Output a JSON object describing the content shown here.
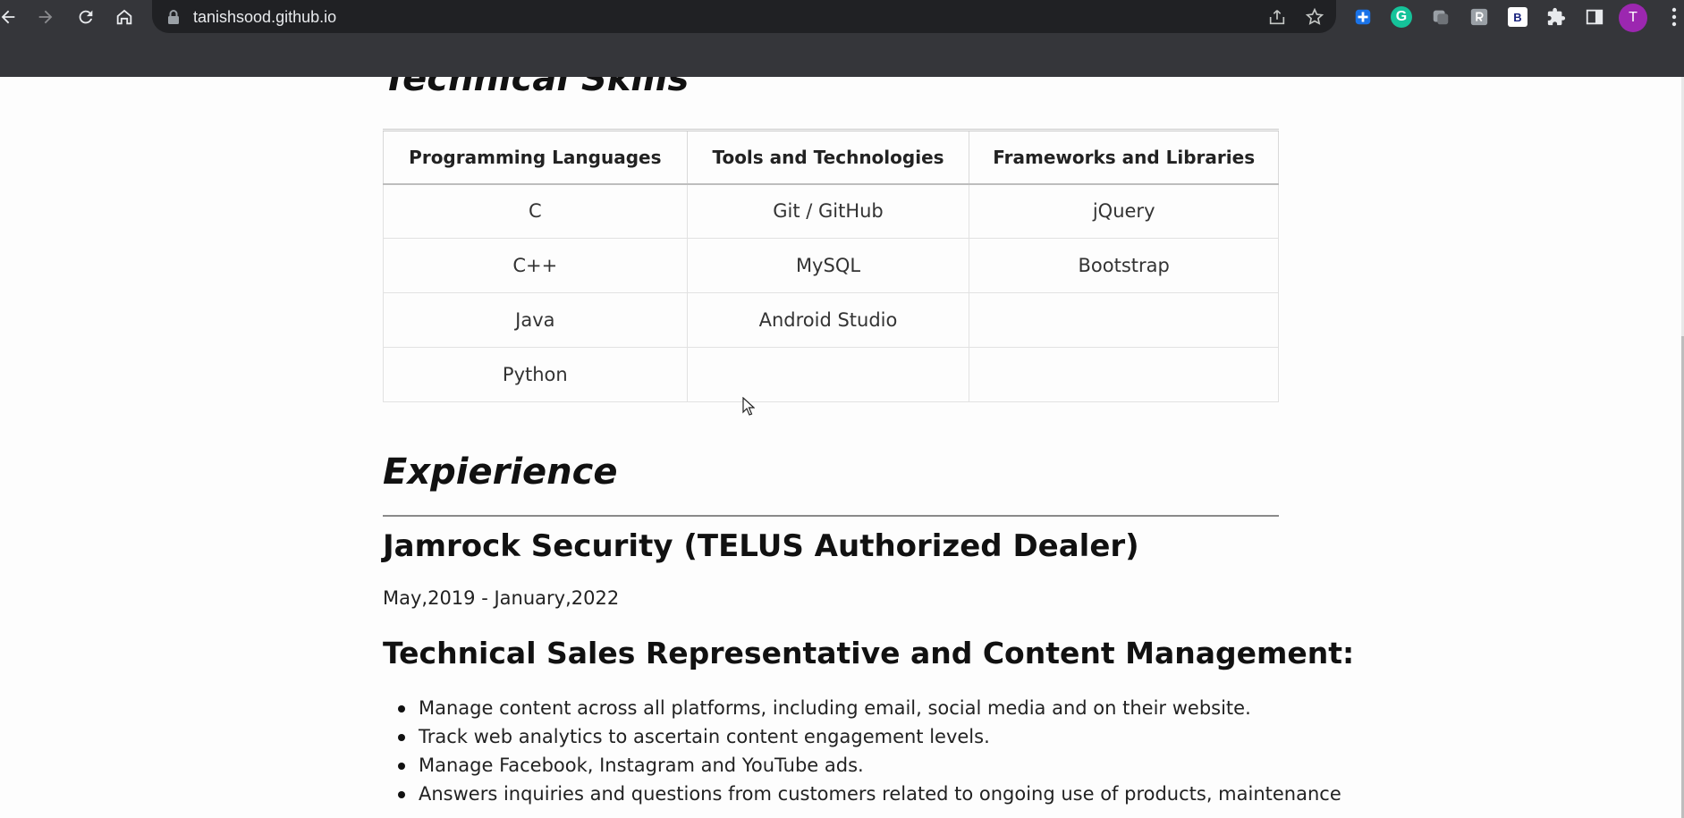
{
  "browser": {
    "url": "tanishsood.github.io",
    "avatar_letter": "T",
    "extensions": [
      "extension-cross-icon",
      "grammarly-icon",
      "extension-gray-icon",
      "extension-r-icon",
      "extension-b-icon",
      "puzzle-icon"
    ],
    "grammarly_letter": "G",
    "b_letter": "B"
  },
  "skills": {
    "title": "Technical Skills",
    "headers": [
      "Programming Languages",
      "Tools and Technologies",
      "Frameworks and Libraries"
    ],
    "rows": [
      [
        "C",
        "Git / GitHub",
        "jQuery"
      ],
      [
        "C++",
        "MySQL",
        "Bootstrap"
      ],
      [
        "Java",
        "Android Studio",
        ""
      ],
      [
        "Python",
        "",
        ""
      ]
    ]
  },
  "experience": {
    "title": "Expierience",
    "job": {
      "company": "Jamrock Security (TELUS Authorized Dealer)",
      "dates": "May,2019 - January,2022",
      "role": "Technical Sales Representative and Content Management:",
      "duties": [
        "Manage content across all platforms, including email, social media and on their website.",
        "Track web analytics to ascertain content engagement levels.",
        "Manage Facebook, Instagram and YouTube ads.",
        "Answers inquiries and questions from customers related to ongoing use of products, maintenance"
      ]
    }
  },
  "colors": {
    "chrome_bg": "#35363a",
    "omnibox_bg": "#202124",
    "avatar_bg": "#9c27b0",
    "grammarly_bg": "#15c39a"
  }
}
